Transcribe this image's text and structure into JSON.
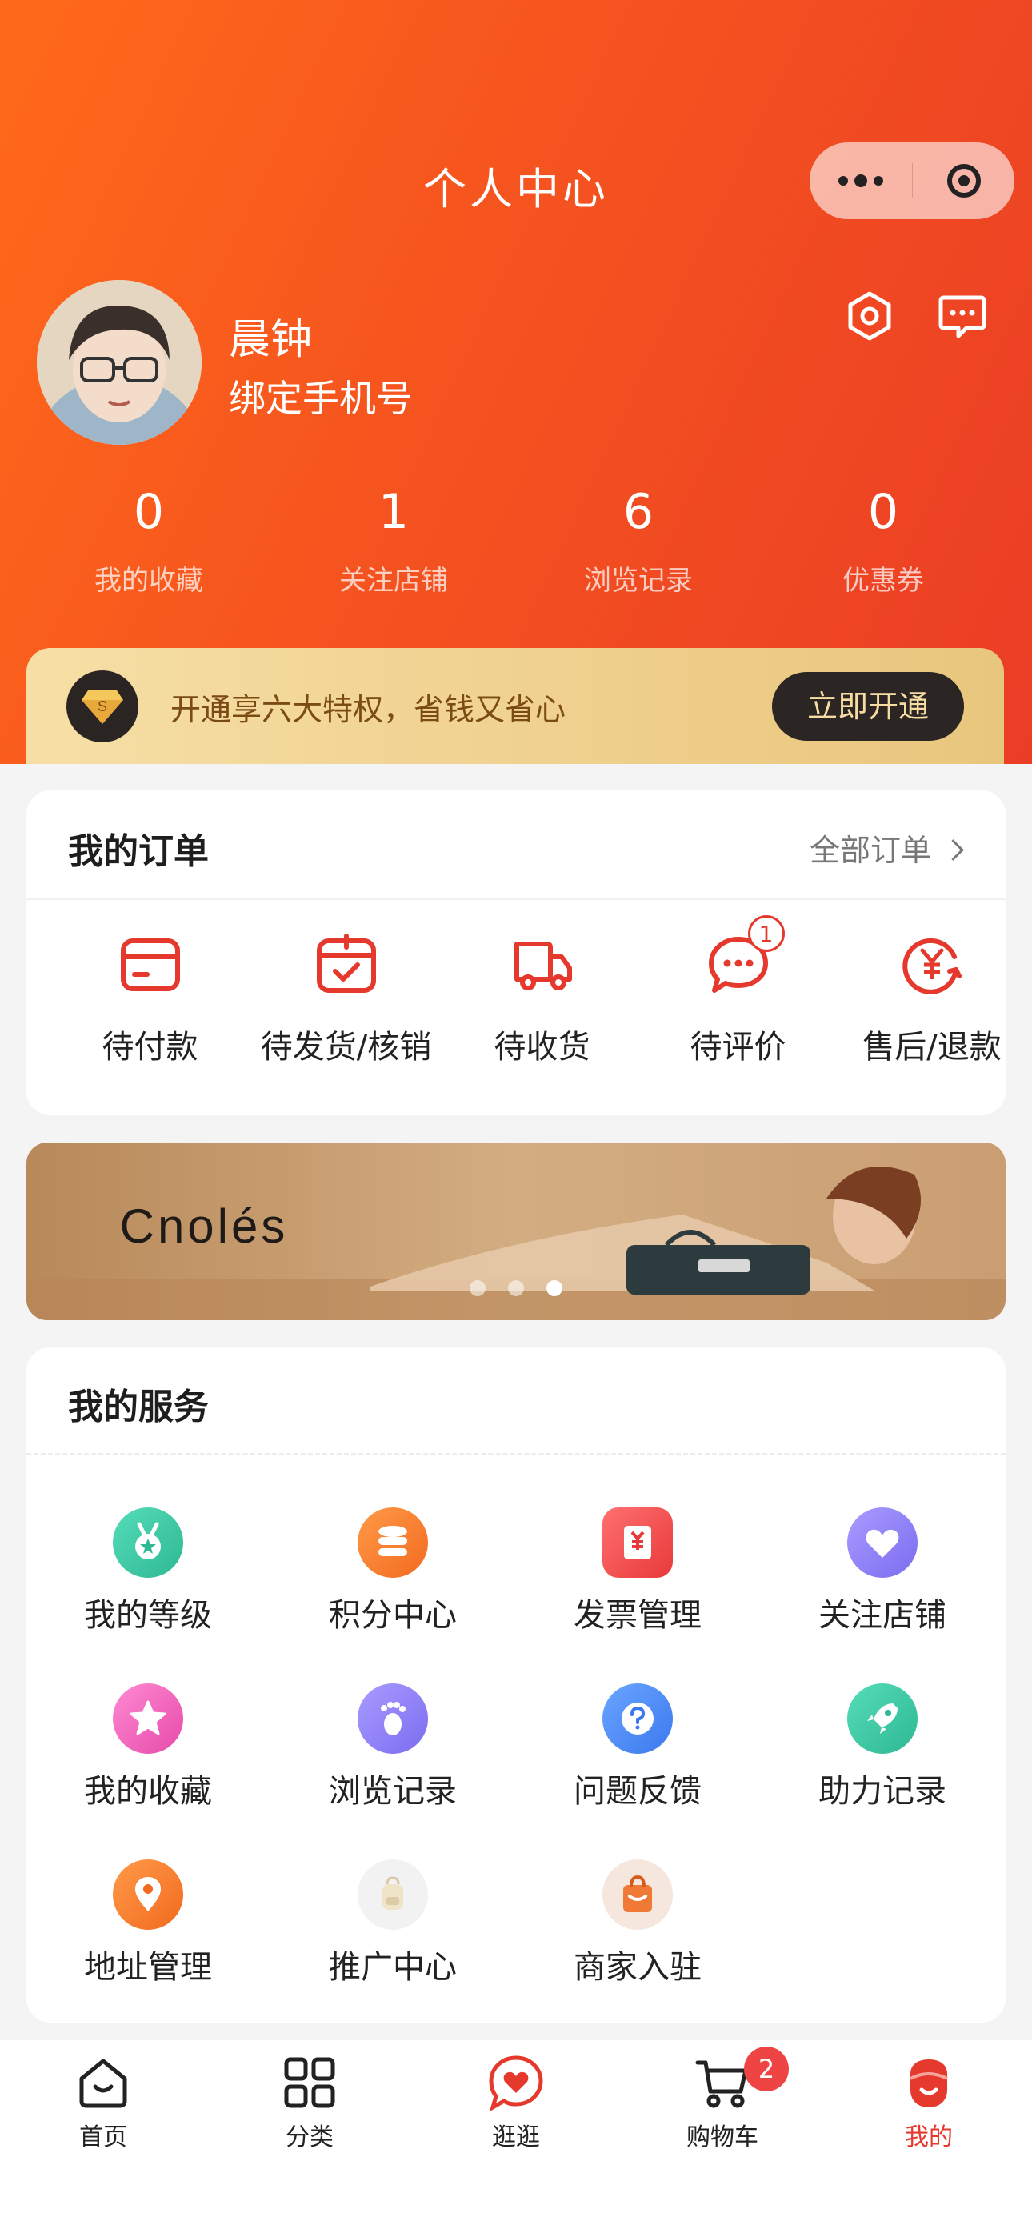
{
  "header": {
    "title": "个人中心",
    "capsule_more_icon": "more-dots-icon",
    "capsule_close_icon": "target-circle-icon",
    "accent_gradient": [
      "#ff6a1a",
      "#ea3d26"
    ]
  },
  "profile": {
    "name": "晨钟",
    "bind_phone": "绑定手机号",
    "settings_icon": "hexagon-settings-icon",
    "message_icon": "message-bubble-icon"
  },
  "stats": [
    {
      "value": "0",
      "label": "我的收藏"
    },
    {
      "value": "1",
      "label": "关注店铺"
    },
    {
      "value": "6",
      "label": "浏览记录"
    },
    {
      "value": "0",
      "label": "优惠券"
    }
  ],
  "vip": {
    "text": "开通享六大特权，省钱又省心",
    "button": "立即开通",
    "icon": "diamond-icon"
  },
  "orders": {
    "title": "我的订单",
    "all_link": "全部订单",
    "items": [
      {
        "label": "待付款",
        "icon": "wallet-icon"
      },
      {
        "label": "待发货/核销",
        "icon": "calendar-check-icon"
      },
      {
        "label": "待收货",
        "icon": "truck-icon"
      },
      {
        "label": "待评价",
        "icon": "chat-dots-icon",
        "badge": "1"
      },
      {
        "label": "售后/退款",
        "icon": "refund-yen-icon"
      }
    ]
  },
  "promo": {
    "brand": "Cnolés",
    "dots": 3,
    "active_dot": 2
  },
  "services": {
    "title": "我的服务",
    "items": [
      {
        "label": "我的等级",
        "icon": "medal-icon",
        "color": "#35c7a3"
      },
      {
        "label": "积分中心",
        "icon": "coins-stack-icon",
        "color": "#f5752b"
      },
      {
        "label": "发票管理",
        "icon": "invoice-yen-icon",
        "color": "#ef4d4d"
      },
      {
        "label": "关注店铺",
        "icon": "heart-icon",
        "color": "#8a7cf2"
      },
      {
        "label": "我的收藏",
        "icon": "star-icon",
        "color": "#ec5ab8"
      },
      {
        "label": "浏览记录",
        "icon": "footprint-icon",
        "color": "#8a7cf2"
      },
      {
        "label": "问题反馈",
        "icon": "question-icon",
        "color": "#4a86f0"
      },
      {
        "label": "助力记录",
        "icon": "rocket-icon",
        "color": "#35c7a3"
      },
      {
        "label": "地址管理",
        "icon": "location-pin-icon",
        "color": "#f5752b"
      },
      {
        "label": "推广中心",
        "icon": "backpack-icon",
        "color": "#f0f0f0"
      },
      {
        "label": "商家入驻",
        "icon": "shopping-bag-icon",
        "color": "#f28a4a"
      }
    ]
  },
  "tabbar": {
    "items": [
      {
        "label": "首页",
        "icon": "home-icon"
      },
      {
        "label": "分类",
        "icon": "grid-icon"
      },
      {
        "label": "逛逛",
        "icon": "heart-chat-icon"
      },
      {
        "label": "购物车",
        "icon": "cart-icon",
        "badge": "2"
      },
      {
        "label": "我的",
        "icon": "user-icon",
        "active": true
      }
    ]
  }
}
